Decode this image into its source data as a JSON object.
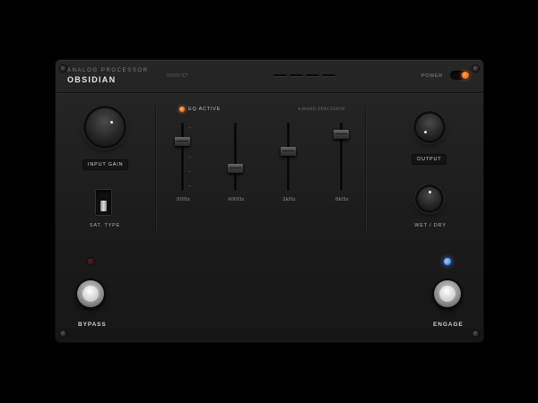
{
  "header": {
    "subtitle": "ANALOG PROCESSOR",
    "title": "OBSIDIAN",
    "model": "MOD-X7",
    "power_label": "POWER",
    "power_on": true
  },
  "left": {
    "input_gain_label": "INPUT GAIN",
    "sat_type_label": "SAT. TYPE"
  },
  "eq": {
    "active_label": "EQ ACTIVE",
    "precision_label": "4-BAND PRECISION",
    "bands": [
      {
        "label": "80Hz"
      },
      {
        "label": "400Hz"
      },
      {
        "label": "2kHz"
      },
      {
        "label": "8kHz"
      }
    ]
  },
  "right": {
    "output_label": "OUTPUT",
    "wet_dry_label": "WET / DRY"
  },
  "footer": {
    "bypass_label": "BYPASS",
    "engage_label": "ENGAGE"
  },
  "colors": {
    "accent_orange": "#ff7a20",
    "led_blue": "#3f8cff",
    "led_red_off": "#5a1e1e"
  }
}
